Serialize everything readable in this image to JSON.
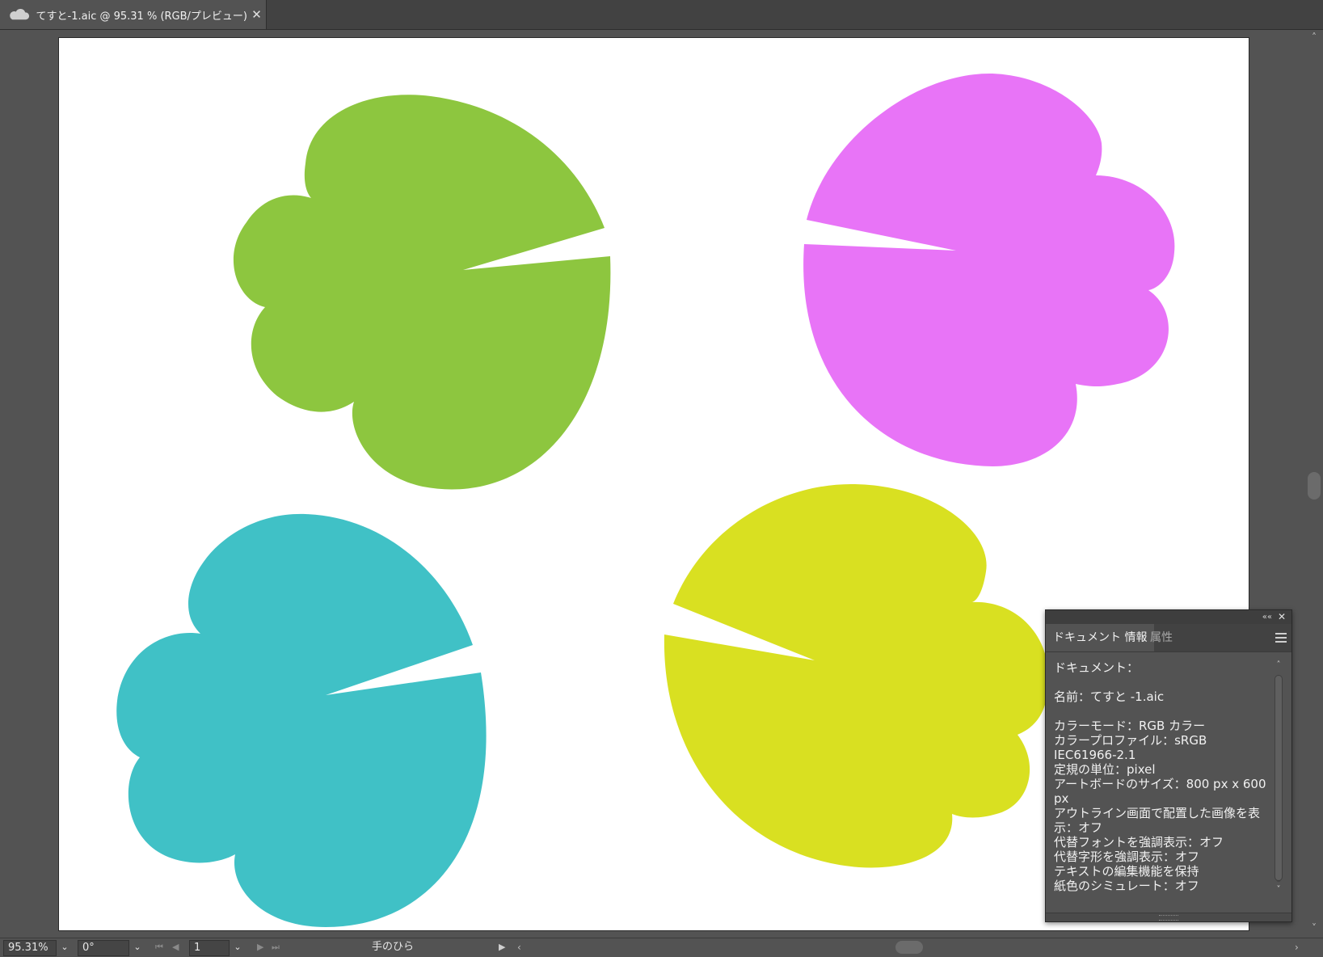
{
  "document_tab": {
    "title": "てすと-1.aic @ 95.31 % (RGB/プレビュー)",
    "close_glyph": "✕",
    "cloud_icon": "cloud-icon"
  },
  "artboard": {
    "background": "#ffffff",
    "shapes": [
      {
        "name": "green-leaf",
        "color": "#8dc63f"
      },
      {
        "name": "magenta-leaf",
        "color": "#e874f7"
      },
      {
        "name": "teal-leaf",
        "color": "#40c1c6"
      },
      {
        "name": "yellow-leaf",
        "color": "#d9e021"
      }
    ]
  },
  "status_bar": {
    "zoom": "95.31%",
    "rotation": "0°",
    "artboard_number": "1",
    "current_tool": "手のひら",
    "dropdown_glyph": "⌄",
    "nav_first": "⏮",
    "nav_prev": "◀",
    "nav_next": "▶",
    "nav_last": "⏭",
    "play_glyph": "▶",
    "scroll_left": "‹",
    "scroll_right": "›"
  },
  "scrollbar": {
    "up": "˄",
    "down": "˅"
  },
  "doc_info_panel": {
    "collapse_glyph": "««",
    "close_glyph": "✕",
    "tabs": [
      "ドキュメント 情報",
      "属性"
    ],
    "lines": [
      "ドキュメント：",
      "",
      "名前：てすと -1.aic",
      "",
      "カラーモード：RGB カラー",
      "カラープロファイル：sRGB IEC61966-2.1",
      "定規の単位：pixel",
      "アートボードのサイズ：800 px x 600 px",
      "アウトライン画面で配置した画像を表示：オフ",
      "代替フォントを強調表示：オフ",
      "代替字形を強調表示：オフ",
      "テキストの編集機能を保持",
      "紙色のシミュレート：オフ"
    ],
    "scroll_up": "˄",
    "scroll_down": "˅"
  }
}
